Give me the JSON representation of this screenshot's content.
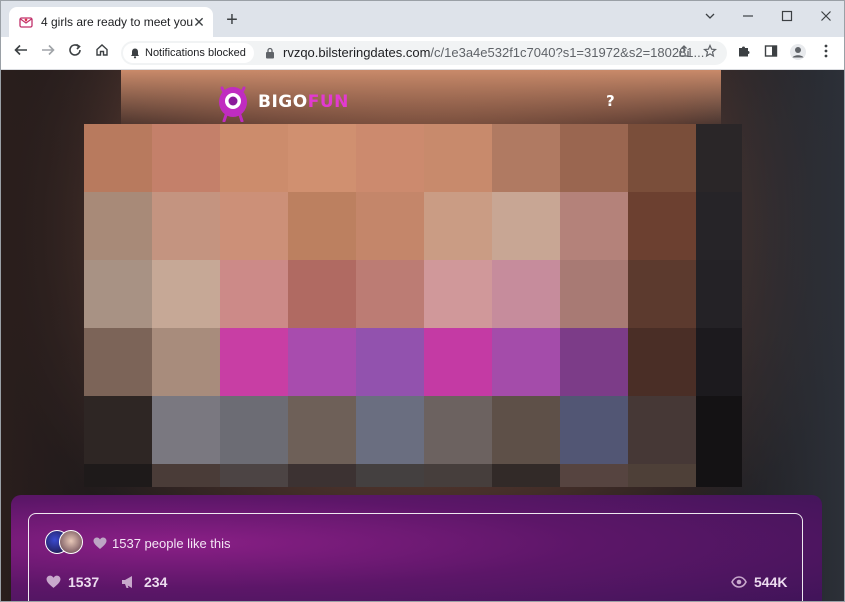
{
  "browser": {
    "tab": {
      "title": "4 girls are ready to meet you",
      "favicon": "envelope-heart-icon"
    },
    "new_tab_icon": "plus-icon",
    "window_controls": [
      "chevron-down-icon",
      "minimize-icon",
      "maximize-icon",
      "close-icon"
    ],
    "notification_chip": "Notifications blocked",
    "url_host": "rvzqo.bilsteringdates.com",
    "url_path": "/c/1e3a4e532f1c7040?s1=31972&s2=180281..."
  },
  "site": {
    "logo_white": "BIGO",
    "logo_pink": "FUN",
    "help": "?",
    "brand_color": "#e23ad0"
  },
  "card": {
    "likes_text": "1537 people like this",
    "likes_count": "1537",
    "shares_count": "234",
    "views_count": "544K"
  },
  "mosaic": {
    "rows": [
      [
        "#b87a5e",
        "#c4806a",
        "#cc8c6c",
        "#d09070",
        "#cc8a6e",
        "#c88a6c",
        "#b07a62",
        "#9a6650",
        "#7a4e3a",
        "#2a2628"
      ],
      [
        "#a88a78",
        "#c49480",
        "#cc9078",
        "#bc8060",
        "#c4866a",
        "#ca9c84",
        "#c8a694",
        "#b4827a",
        "#6c4030",
        "#262428"
      ],
      [
        "#a89284",
        "#c6a896",
        "#cc8a88",
        "#b06a62",
        "#bc7c74",
        "#d0989a",
        "#c68c9c",
        "#a87a74",
        "#5c3a2e",
        "#242226"
      ],
      [
        "#7c6458",
        "#a88c7c",
        "#c83ea4",
        "#a84cae",
        "#9252ae",
        "#c43aa4",
        "#a44caa",
        "#7c3c88",
        "#4a2e26",
        "#1c1a1e"
      ],
      [
        "#2e2624",
        "#7a7880",
        "#6c6c74",
        "#6e6058",
        "#6a6e80",
        "#6c6260",
        "#5e5048",
        "#525674",
        "#463836",
        "#141214"
      ],
      [
        "#1e1a1a",
        "#4a3c38",
        "#4c4444",
        "#3c3232",
        "#444040",
        "#463e3c",
        "#322a28",
        "#564440",
        "#4e4038",
        "#141214"
      ]
    ]
  }
}
